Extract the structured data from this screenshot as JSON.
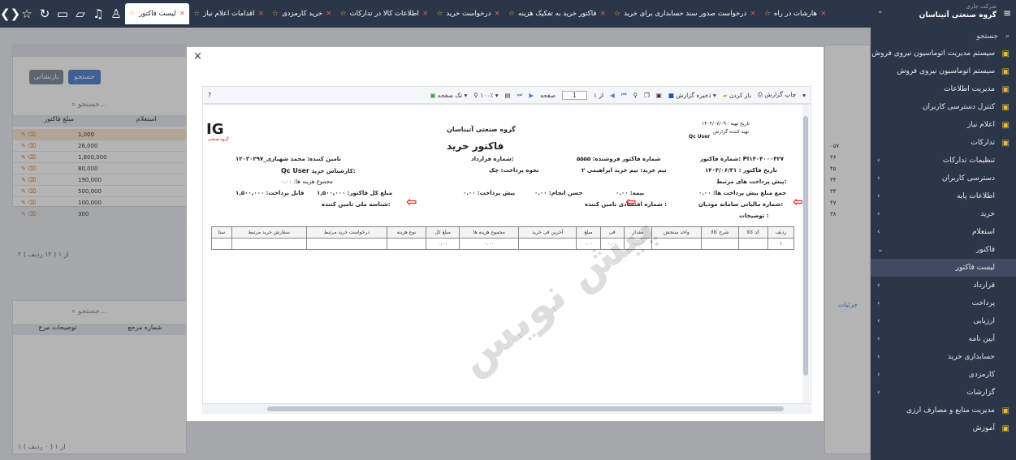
{
  "sidebar": {
    "company_label": "شرکت جاری",
    "company_name": "گروه صنعتی آتیناسان",
    "search": "جستجو",
    "items": [
      "سیستم مدیریت اتوماسیون نیروی فروش",
      "سیستم اتوماسیون نیروی فروش",
      "مدیریت اطلاعات",
      "کنترل دسترسی کاربران",
      "اعلام نیاز",
      "تدارکات",
      "تنظیمات تدارکات",
      "دسترسی کاربران",
      "اطلاعات پایه",
      "خرید",
      "استعلام",
      "فاکتور",
      "لیست فاکتور",
      "قرارداد",
      "پرداخت",
      "ارزیابی",
      "آیین نامه",
      "حسابداری خرید",
      "کارمزدی",
      "گزارشات",
      "مدیریت منابع و مصارف ارزی",
      "آموزش"
    ]
  },
  "tabs": [
    "لیست فاکتور",
    "اقدامات اعلام نیاز",
    "خرید کارمزدی",
    "اطلاعات کالا در تدارکات",
    "درخواست خرید",
    "فاکتور خرید به تفکیک هزینه",
    "درخواست صدور سند حسابداری برای خرید",
    "هارشات در راه"
  ],
  "left_panel": {
    "search_btn": "جستجو",
    "reset_btn": "بازنشانی",
    "search_ph": "جستجو...",
    "col_amount": "مبلغ فاکتور",
    "col_inquiry": "استعلام",
    "amounts": [
      "1,000",
      "26,000",
      "1,800,000",
      "80,000",
      "190,000",
      "500,000",
      "100,000",
      "300"
    ],
    "pager": "( ۱۲ ردیف )",
    "pager_nums": "۲ از ۱",
    "col_ref": "شماره مرجع",
    "col_notes": "توضیحات مرج",
    "pager2": "( ۰ ردیف )",
    "pager2_nums": "۱ از ۱"
  },
  "right_panel": {
    "codes": [
      "۰۵۷",
      "۳۶",
      "۴۵",
      "۴۴",
      "۳۳",
      "۴۷",
      "۳۸"
    ],
    "detail": "جزئیات",
    "ln": "۱۰"
  },
  "modal": {
    "close": "×",
    "toolbar": {
      "print": "چاپ گزارش",
      "open": "باز کردن",
      "save": "ذخیره گزارش",
      "page_label": "صفحه",
      "page_num": "1",
      "page_of": "از ۱",
      "zoom": "۱۰۰٪",
      "single_page": "تک صفحه",
      "help": "?"
    },
    "doc": {
      "company": "گروه صنعتی آتیناسان",
      "title": "فاکتور خرید",
      "logo": "IG",
      "logo_sub": "گروه صنعتی",
      "date_label": "تاریخ تهیه : ۱۴۰۴/۰۷/۰۹",
      "preparer_label": "تهیه کننده گزارش",
      "preparer": "Qc User",
      "invoice_no": "شماره فاکتور:  PI۱۴۰۴۰۰۰۴۲۷",
      "seller_invoice_no": "شماره فاکتور فروشنده: ۵۵۵۵",
      "contract_no": "شماره قرارداد:",
      "supplier": "تامین کننده: محمد شهبازی_۱۲۰۳۰۲۹۷",
      "invoice_date": "تاریخ فاکتور : ۱۴۰۴/۰۶/۳۱",
      "buy_team": "تیم خرید:   تیم خرید ابراهیمی ۲",
      "payment_method": "نحوه پرداخت:   چک",
      "buyer_expert": "کارشناس خرید:",
      "buyer_expert_val": "Qc User",
      "related_prepay": "پیش پرداخت های مرتبط:",
      "cost_sum": "مجموع هزینه ها: ۰.۰۰",
      "prepay_sum": "جمع مبلغ پیش پرداخت ها: ۰.۰۰",
      "insurance": "بیمه: ۰.۰۰",
      "good_perf": "حسن انجام: ۰.۰۰",
      "prepay": "پیش پرداخت: ۰.۰۰",
      "total": "مبلغ کل فاکتور: ۱,۵۰۰,۰۰۰",
      "payable": "قابل پرداخت: ۱,۵۰۰,۰۰۰",
      "tax_id": "شماره مالیاتی سامانه مودیان:",
      "econ_code": "شماره اقتصادی تامین کننده :",
      "national_id": "شناسه ملی تامین کننده:",
      "notes": "توضیحات :",
      "watermark": "پیش نویس",
      "cols": [
        "ردیف",
        "کد کالا",
        "شرح کالا",
        "واحد سنجش",
        "مقدار",
        "فی",
        "مبلغ",
        "آخرین فی خرید",
        "مجموع هزینه ها",
        "مبلغ کل",
        "نوع هزینه",
        "درخواست خرید مرتبط",
        "سفارش خرید مرتبط",
        "ستا"
      ],
      "row": [
        "۱",
        "",
        "",
        "",
        "۰.۰۰۰",
        "۰.۰۰",
        "۰.۰۰",
        "",
        "۰.۰۰",
        "۰.۰۰",
        "",
        "",
        "",
        ""
      ]
    }
  }
}
